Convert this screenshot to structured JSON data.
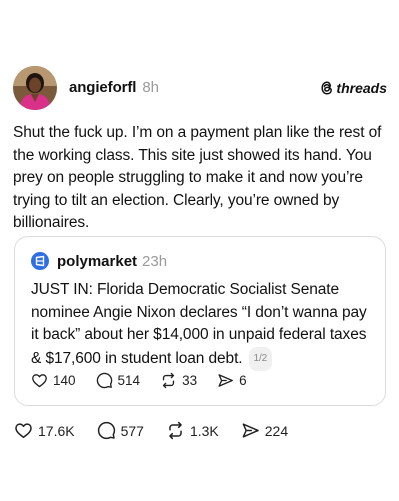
{
  "brand": {
    "logo_text": "threads",
    "logo_icon": "threads-icon"
  },
  "post": {
    "username": "angieforfl",
    "time": "8h",
    "text": "Shut the fuck up. I’m on a payment plan like the rest of the working class. This site just showed its hand. You prey on people struggling to make it and now you’re trying to tilt an election. Clearly, you’re owned by billionaires.",
    "stats": {
      "likes": "17.6K",
      "replies": "577",
      "reposts": "1.3K",
      "shares": "224"
    }
  },
  "quoted_post": {
    "username": "polymarket",
    "time": "23h",
    "avatar_color": "#2f6fe4",
    "text": "JUST IN: Florida Democratic Socialist Senate nominee Angie Nixon declares “I don’t wanna pay it back” about her $14,000 in unpaid federal taxes & $17,600 in student loan debt.",
    "page_indicator": "1/2",
    "stats": {
      "likes": "140",
      "replies": "514",
      "reposts": "33",
      "shares": "6"
    }
  },
  "icons": [
    "heart-icon",
    "comment-icon",
    "repost-icon",
    "share-icon"
  ]
}
